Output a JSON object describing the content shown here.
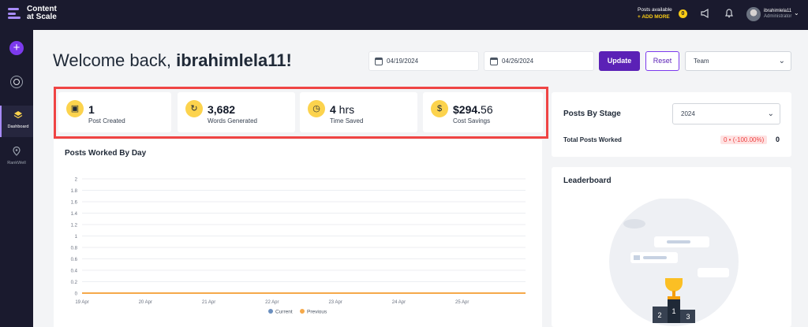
{
  "app": {
    "logo_line1": "Content",
    "logo_line2": "at Scale"
  },
  "topbar": {
    "posts_available_label": "Posts available",
    "add_more_label": "+ ADD MORE",
    "posts_count": "0",
    "user_name": "ibrahimlela11",
    "user_role": "Administrator"
  },
  "sidebar": {
    "items": [
      {
        "label": "Dashboard",
        "icon": "layers-icon"
      },
      {
        "label": "RankWell",
        "icon": "location-pin-icon"
      }
    ]
  },
  "header": {
    "welcome_prefix": "Welcome back, ",
    "username": "ibrahimlela11!",
    "start_date": "04/19/2024",
    "end_date": "04/26/2024",
    "update_label": "Update",
    "reset_label": "Reset",
    "team_label": "Team"
  },
  "stats": [
    {
      "value": "1",
      "unit": "",
      "label": "Post Created",
      "icon": "document-icon"
    },
    {
      "value": "3,682",
      "unit": "",
      "label": "Words Generated",
      "icon": "text-icon"
    },
    {
      "value": "4",
      "unit": " hrs",
      "label": "Time Saved",
      "icon": "clock-icon"
    },
    {
      "value": "$294.",
      "unit": "56",
      "label": "Cost Savings",
      "icon": "dollar-icon"
    }
  ],
  "posts_by_stage": {
    "title": "Posts By Stage",
    "year": "2024",
    "total_label": "Total Posts Worked",
    "change": "0 • (-100.00%)",
    "total_value": "0"
  },
  "leaderboard": {
    "title": "Leaderboard"
  },
  "colors": {
    "accent": "#5b21b6",
    "current": "#6b8fbf",
    "previous": "#f5a94a",
    "stat_icon": "#fcd34d",
    "highlight": "#ef4444"
  },
  "chart_data": {
    "type": "line",
    "title": "Posts Worked By Day",
    "categories": [
      "19 Apr",
      "20 Apr",
      "21 Apr",
      "22 Apr",
      "23 Apr",
      "24 Apr",
      "25 Apr"
    ],
    "yticks": [
      "2",
      "1.8",
      "1.6",
      "1.4",
      "1.2",
      "1",
      "0.8",
      "0.6",
      "0.4",
      "0.2",
      "0"
    ],
    "ylim": [
      0,
      2
    ],
    "grid": true,
    "legend_position": "bottom",
    "series": [
      {
        "name": "Current",
        "values": [
          0,
          0,
          0,
          0,
          0,
          0,
          0,
          0
        ]
      },
      {
        "name": "Previous",
        "values": [
          0,
          0,
          0,
          0,
          0,
          0,
          0,
          0
        ]
      }
    ]
  }
}
